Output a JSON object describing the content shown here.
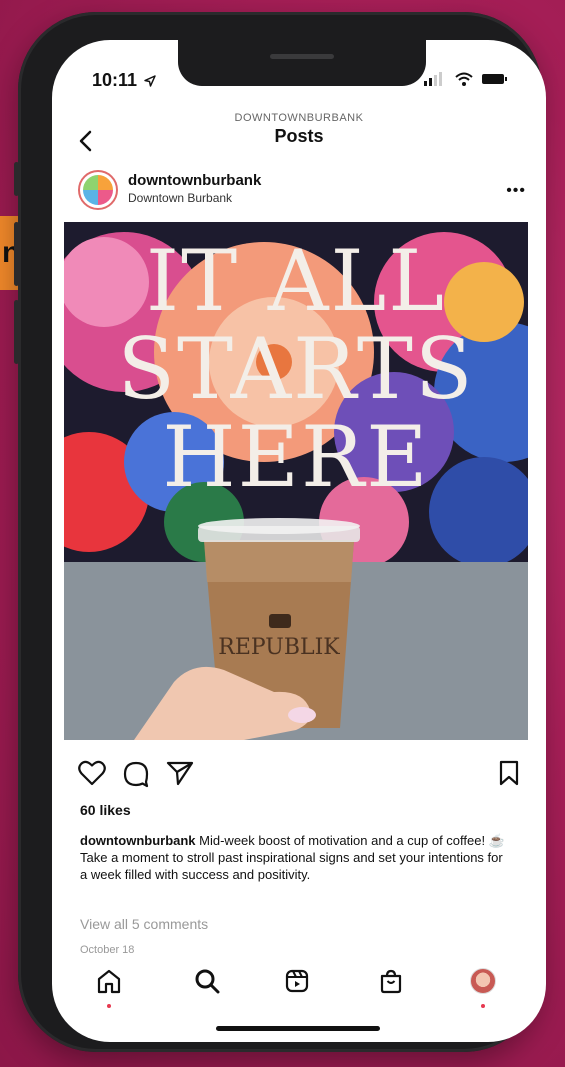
{
  "status_bar": {
    "time": "10:11"
  },
  "header": {
    "username": "DOWNTOWNBURBANK",
    "title": "Posts"
  },
  "post": {
    "username": "downtownburbank",
    "subtitle": "Downtown Burbank",
    "image_text_lines": [
      "IT ALL",
      "STARTS",
      "HERE"
    ],
    "cup_text": "REPUBLIK",
    "likes": "60 likes",
    "caption_user": "downtownburbank",
    "caption_text": " Mid-week boost of motivation and a cup of coffee! ☕ Take a moment to stroll past inspirational signs and set your intentions for a week filled with success and positivity.",
    "comments_link": "View all 5 comments",
    "date": "October 18"
  },
  "side_tab": {
    "text": "n"
  },
  "icons": {
    "back": "chevron-left-icon",
    "more": "more-icon",
    "like": "heart-icon",
    "comment": "comment-icon",
    "share": "send-icon",
    "save": "bookmark-icon",
    "home": "home-icon",
    "search": "search-icon",
    "reels": "reels-icon",
    "shop": "shop-icon",
    "profile": "profile-avatar"
  },
  "colors": {
    "background": "#a81f58",
    "accent_orange": "#f0882a",
    "notification_dot": "#e63950"
  }
}
